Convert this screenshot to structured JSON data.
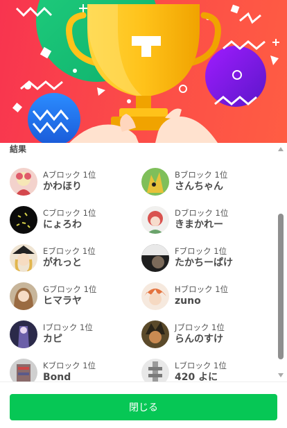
{
  "result_section": {
    "title": "結果"
  },
  "results": [
    {
      "block": "Aブロック 1位",
      "name": "かわほり",
      "avatar_color": "#f3c7c0"
    },
    {
      "block": "Bブロック 1位",
      "name": "さんちゃん",
      "avatar_color": "#d9b73a"
    },
    {
      "block": "Cブロック 1位",
      "name": "にょろわ",
      "avatar_color": "#111111"
    },
    {
      "block": "Dブロック 1位",
      "name": "きまかれー",
      "avatar_color": "#e8a3a0"
    },
    {
      "block": "Eブロック 1位",
      "name": "がれっと",
      "avatar_color": "#c6a064"
    },
    {
      "block": "Fブロック 1位",
      "name": "たかちーぱけ",
      "avatar_color": "#3a3a3a"
    },
    {
      "block": "Gブロック 1位",
      "name": "ヒマラヤ",
      "avatar_color": "#d8b48e"
    },
    {
      "block": "Hブロック 1位",
      "name": "zuno",
      "avatar_color": "#e27e52"
    },
    {
      "block": "Iブロック 1位",
      "name": "カピ",
      "avatar_color": "#3b3a5e"
    },
    {
      "block": "Jブロック 1位",
      "name": "らんのすけ",
      "avatar_color": "#9b6b3a"
    },
    {
      "block": "Kブロック 1位",
      "name": "Bond",
      "avatar_color": "#8a7a7a"
    },
    {
      "block": "Lブロック 1位",
      "name": "420 よに",
      "avatar_color": "#b9b9b9"
    }
  ],
  "footer": {
    "close_label": "閉じる"
  },
  "colors": {
    "primary_button": "#06c755",
    "hero_red": "#f8344f"
  },
  "hero": {
    "icon": "trophy-icon"
  }
}
